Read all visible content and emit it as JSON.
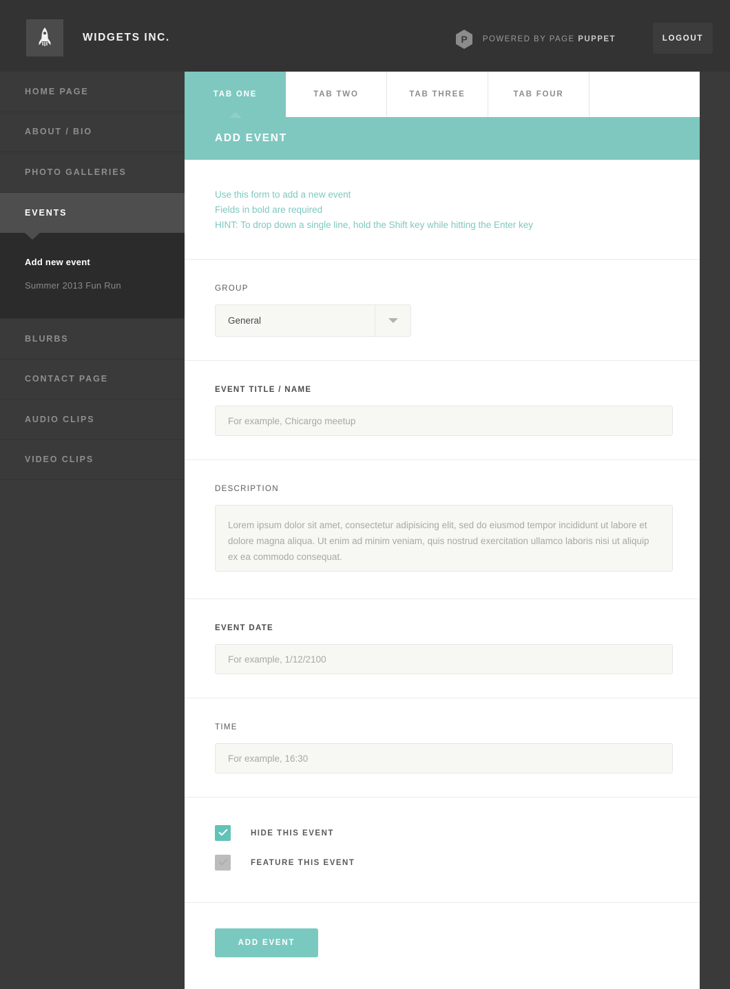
{
  "header": {
    "logo_icon": "rocket-icon",
    "brand_name": "WIDGETS INC.",
    "powered_badge_letter": "P",
    "powered_prefix": "POWERED BY PAGE ",
    "powered_brand": "PUPPET",
    "logout_label": "LOGOUT",
    "bg_color": "#333333"
  },
  "sidebar": {
    "items": [
      {
        "label": "HOME PAGE",
        "active": false
      },
      {
        "label": "ABOUT / BIO",
        "active": false
      },
      {
        "label": "PHOTO GALLERIES",
        "active": false
      },
      {
        "label": "EVENTS",
        "active": true
      },
      {
        "label": "BLURBS",
        "active": false
      },
      {
        "label": "CONTACT PAGE",
        "active": false
      },
      {
        "label": "AUDIO CLIPS",
        "active": false
      },
      {
        "label": "VIDEO CLIPS",
        "active": false
      }
    ],
    "submenu": [
      {
        "label": "Add new event",
        "current": true
      },
      {
        "label": "Summer 2013 Fun Run",
        "current": false
      }
    ]
  },
  "tabs": [
    {
      "label": "TAB ONE",
      "active": true
    },
    {
      "label": "TAB TWO",
      "active": false
    },
    {
      "label": "TAB THREE",
      "active": false
    },
    {
      "label": "TAB FOUR",
      "active": false
    }
  ],
  "panel": {
    "title": "ADD EVENT",
    "accent_color": "#7ec8c0",
    "intro": {
      "line1": "Use this form to add a new event",
      "line2": "Fields in bold are required",
      "line3": "HINT: To drop down a single line, hold the Shift key while hitting the Enter key"
    },
    "fields": {
      "group": {
        "label": "GROUP",
        "required": false,
        "value": "General",
        "caret_icon": "chevron-down-icon"
      },
      "event_title": {
        "label": "EVENT TITLE / NAME",
        "required": true,
        "value": "",
        "placeholder": "For example, Chicargo meetup"
      },
      "description": {
        "label": "DESCRIPTION",
        "required": false,
        "value": "",
        "placeholder": "Lorem ipsum dolor sit amet, consectetur adipisicing elit, sed do eiusmod tempor incididunt ut labore et dolore magna aliqua. Ut enim ad minim veniam, quis nostrud exercitation ullamco laboris nisi ut aliquip ex ea commodo consequat."
      },
      "event_date": {
        "label": "EVENT DATE",
        "required": true,
        "value": "",
        "placeholder": "For example, 1/12/2100"
      },
      "time": {
        "label": "TIME",
        "required": false,
        "value": "",
        "placeholder": "For example, 16:30"
      }
    },
    "checkboxes": [
      {
        "label": "HIDE THIS EVENT",
        "checked": true,
        "color": "#63c2b8"
      },
      {
        "label": "FEATURE THIS EVENT",
        "checked": false,
        "color": "#bcbcbc"
      }
    ],
    "submit_label": "ADD EVENT"
  }
}
